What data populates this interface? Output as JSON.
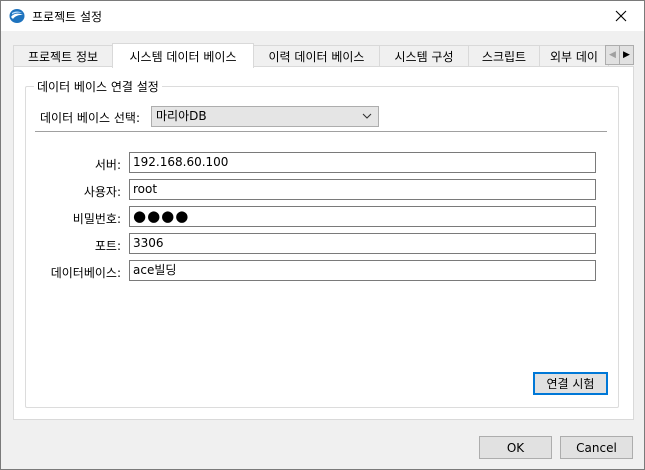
{
  "window": {
    "title": "프로젝트 설정",
    "icon": "app-logo-icon",
    "close_icon": "close-icon"
  },
  "tabs": [
    {
      "label": "프로젝트 정보",
      "active": false
    },
    {
      "label": "시스템 데이터 베이스",
      "active": true
    },
    {
      "label": "이력 데이터 베이스",
      "active": false
    },
    {
      "label": "시스템 구성",
      "active": false
    },
    {
      "label": "스크립트",
      "active": false
    },
    {
      "label": "외부 데이",
      "active": false
    }
  ],
  "tab_scroll": {
    "left": "◀",
    "right": "▶"
  },
  "group": {
    "legend": "데이터 베이스 연결 설정",
    "db_select_label": "데이터 베이스 선택:",
    "db_select_value": "마리아DB"
  },
  "fields": {
    "server": {
      "label": "서버:",
      "value": "192.168.60.100"
    },
    "user": {
      "label": "사용자:",
      "value": "root"
    },
    "password": {
      "label": "비밀번호:",
      "value": "●●●●"
    },
    "port": {
      "label": "포트:",
      "value": "3306"
    },
    "database": {
      "label": "데이터베이스:",
      "value": "ace빌딩"
    }
  },
  "buttons": {
    "test": "연결 시험",
    "ok": "OK",
    "cancel": "Cancel"
  },
  "colors": {
    "accent": "#0078d7",
    "app_icon": "#1e73be"
  }
}
